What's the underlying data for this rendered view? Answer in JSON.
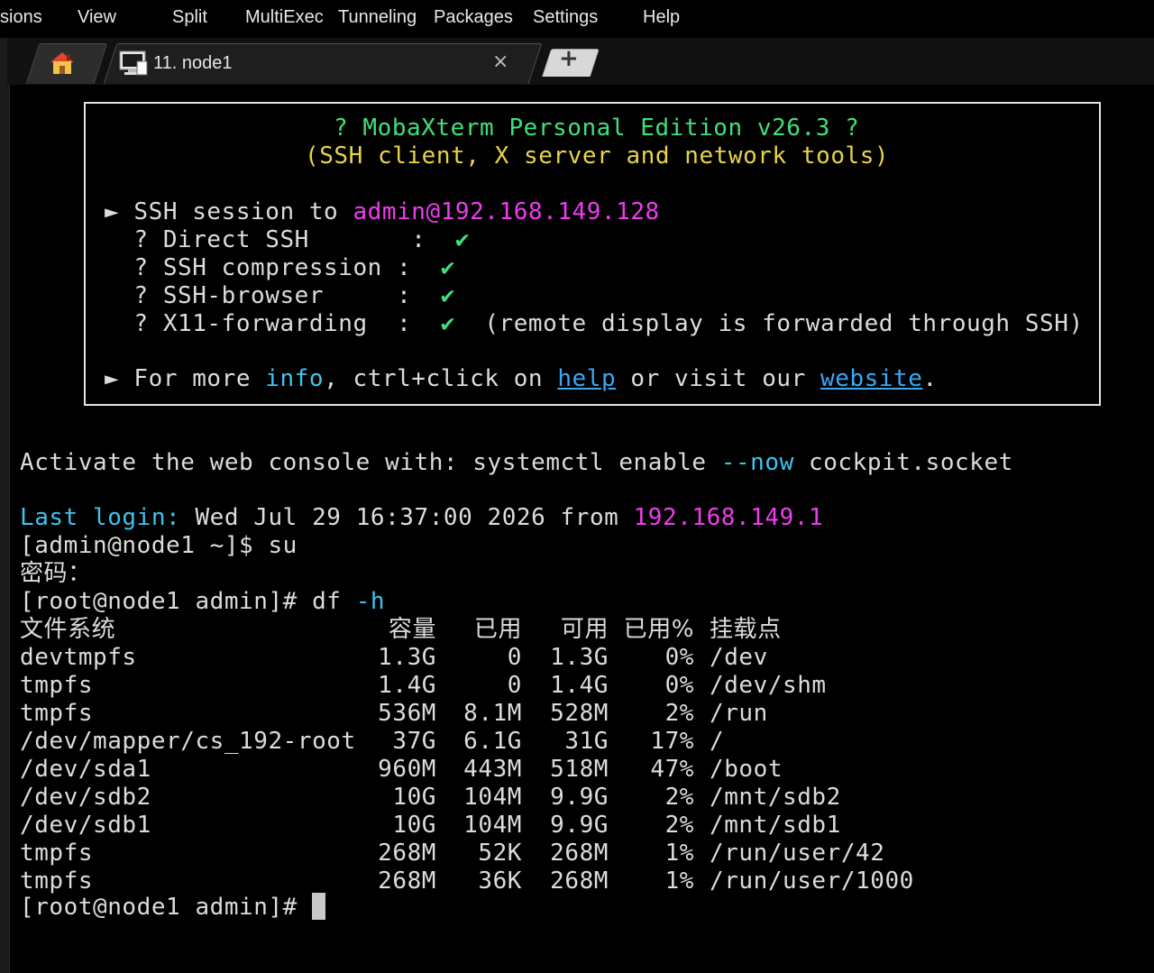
{
  "menu": {
    "items": [
      "sions",
      "View",
      "Split",
      "MultiExec",
      "Tunneling",
      "Packages",
      "Settings",
      "Help"
    ]
  },
  "tabs": {
    "home_icon": "home-icon",
    "session_label": "11. node1",
    "session_icon": "terminal-session-icon",
    "close_label": "×",
    "new_tab_label": "+"
  },
  "banner": {
    "title": "? MobaXterm Personal Edition v26.3 ?",
    "subtitle": "(SSH client, X server and network tools)",
    "session_prefix": "► SSH session to ",
    "session_target": "admin@192.168.149.128",
    "features": [
      {
        "line": "  ? Direct SSH       :  ",
        "check": "✔",
        "note": ""
      },
      {
        "line": "  ? SSH compression :  ",
        "check": "✔",
        "note": ""
      },
      {
        "line": "  ? SSH-browser     :  ",
        "check": "✔",
        "note": ""
      },
      {
        "line": "  ? X11-forwarding  :  ",
        "check": "✔",
        "note": "  (remote display is forwarded through SSH)"
      }
    ],
    "more_prefix": "► For more ",
    "more_info": "info",
    "more_mid": ", ctrl+click on ",
    "more_help": "help",
    "more_mid2": " or visit our ",
    "more_website": "website",
    "more_end": "."
  },
  "terminal": {
    "activate_prefix": "Activate the web console with: systemctl enable ",
    "activate_flag": "--now",
    "activate_suffix": " cockpit.socket",
    "last_login_label": "Last login:",
    "last_login_text": " Wed Jul 29 16:37:00 2026 from ",
    "last_login_ip": "192.168.149.1",
    "prompt_user": "[admin@node1 ~]$ su",
    "password_prompt": "密码：",
    "prompt_root_cmd": "[root@node1 admin]# df ",
    "cmd_flag": "-h",
    "df_header": [
      "文件系统",
      "容量",
      "已用",
      "可用",
      "已用%",
      "挂载点"
    ],
    "df_rows": [
      [
        "devtmpfs",
        "1.3G",
        "0",
        "1.3G",
        "0%",
        "/dev"
      ],
      [
        "tmpfs",
        "1.4G",
        "0",
        "1.4G",
        "0%",
        "/dev/shm"
      ],
      [
        "tmpfs",
        "536M",
        "8.1M",
        "528M",
        "2%",
        "/run"
      ],
      [
        "/dev/mapper/cs_192-root",
        "37G",
        "6.1G",
        "31G",
        "17%",
        "/"
      ],
      [
        "/dev/sda1",
        "960M",
        "443M",
        "518M",
        "47%",
        "/boot"
      ],
      [
        "/dev/sdb2",
        "10G",
        "104M",
        "9.9G",
        "2%",
        "/mnt/sdb2"
      ],
      [
        "/dev/sdb1",
        "10G",
        "104M",
        "9.9G",
        "2%",
        "/mnt/sdb1"
      ],
      [
        "tmpfs",
        "268M",
        "52K",
        "268M",
        "1%",
        "/run/user/42"
      ],
      [
        "tmpfs",
        "268M",
        "36K",
        "268M",
        "1%",
        "/run/user/1000"
      ]
    ],
    "final_prompt": "[root@node1 admin]# "
  },
  "colors": {
    "green": "#3fe07a",
    "yellow": "#e7d44a",
    "magenta": "#ef3cef",
    "cyan": "#3ec3ee",
    "link": "#3aa8f5"
  }
}
